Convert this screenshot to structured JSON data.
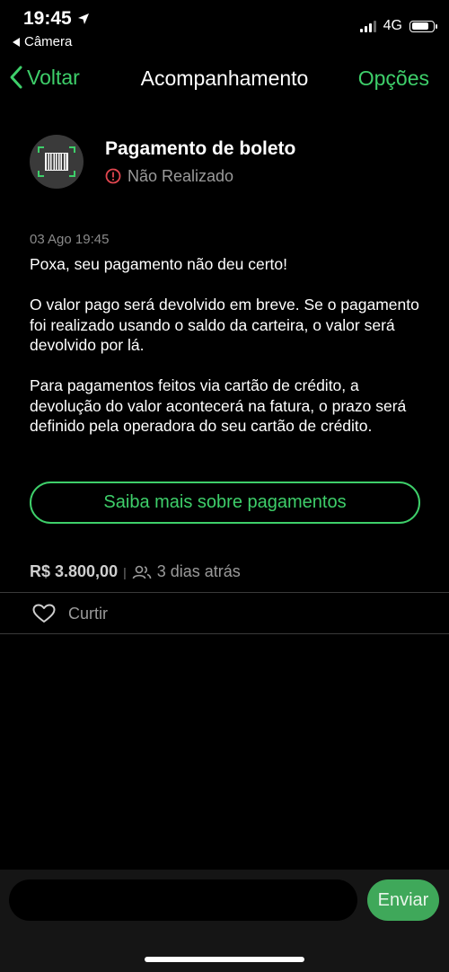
{
  "status_bar": {
    "time": "19:45",
    "back_app": "Câmera",
    "network": "4G"
  },
  "nav": {
    "back_label": "Voltar",
    "title": "Acompanhamento",
    "options_label": "Opções"
  },
  "transaction": {
    "title": "Pagamento de boleto",
    "status": "Não Realizado",
    "date": "03 Ago 19:45",
    "message": [
      "Poxa, seu pagamento não deu certo!",
      "O valor pago será devolvido em breve. Se o pagamento foi realizado usando o saldo da carteira, o valor será devolvido por lá.",
      "Para pagamentos feitos via cartão de crédito, a devolução do valor acontecerá na fatura, o prazo será definido pela operadora do seu cartão de crédito."
    ],
    "info_button": "Saiba mais sobre pagamentos",
    "amount": "R$ 3.800,00",
    "time_ago": "3 dias atrás"
  },
  "actions": {
    "like_label": "Curtir"
  },
  "comment": {
    "placeholder": "",
    "send_label": "Enviar"
  },
  "colors": {
    "accent": "#3ecf6a",
    "error": "#e0464f",
    "send_bg": "#3fa85a"
  },
  "icons": [
    "location-arrow-icon",
    "back-triangle-icon",
    "signal-icon",
    "battery-icon",
    "chevron-left-icon",
    "barcode-icon",
    "alert-circle-icon",
    "people-icon",
    "heart-icon"
  ]
}
